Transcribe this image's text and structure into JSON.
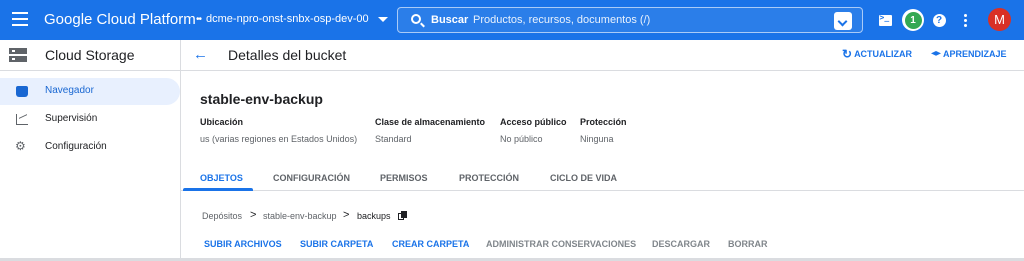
{
  "topbar": {
    "brand": "Google Cloud Platform",
    "project": "dcme-npro-onst-snbx-osp-dev-00",
    "search_label": "Buscar",
    "search_placeholder": "Productos, recursos, documentos (/)",
    "notifications_count": "1",
    "help_glyph": "?",
    "avatar_initial": "M",
    "colors": {
      "bar": "#1a73e8",
      "avatar": "#d93025",
      "badge": "#34a853"
    }
  },
  "sidebar": {
    "title": "Cloud Storage",
    "items": [
      {
        "label": "Navegador",
        "icon": "bucket-icon",
        "active": true
      },
      {
        "label": "Supervisión",
        "icon": "chart-icon",
        "active": false
      },
      {
        "label": "Configuración",
        "icon": "gear-icon",
        "active": false
      }
    ]
  },
  "header": {
    "title": "Detalles del bucket",
    "refresh": "ACTUALIZAR",
    "learn": "APRENDIZAJE"
  },
  "bucket": {
    "name": "stable-env-backup",
    "fields": [
      {
        "label": "Ubicación",
        "value": "us (varias regiones en Estados Unidos)"
      },
      {
        "label": "Clase de almacenamiento",
        "value": "Standard"
      },
      {
        "label": "Acceso público",
        "value": "No público"
      },
      {
        "label": "Protección",
        "value": "Ninguna"
      }
    ]
  },
  "tabs": [
    "OBJETOS",
    "CONFIGURACIÓN",
    "PERMISOS",
    "PROTECCIÓN",
    "CICLO DE VIDA"
  ],
  "breadcrumb": [
    "Depósitos",
    "stable-env-backup",
    "backups"
  ],
  "breadcrumb_separator": ">",
  "actions": [
    {
      "label": "SUBIR ARCHIVOS",
      "enabled": true
    },
    {
      "label": "SUBIR CARPETA",
      "enabled": true
    },
    {
      "label": "CREAR CARPETA",
      "enabled": true
    },
    {
      "label": "ADMINISTRAR CONSERVACIONES",
      "enabled": false
    },
    {
      "label": "DESCARGAR",
      "enabled": false
    },
    {
      "label": "BORRAR",
      "enabled": false
    }
  ]
}
